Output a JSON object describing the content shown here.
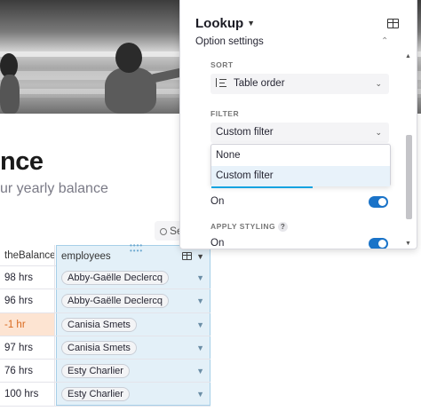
{
  "page": {
    "title": "nce",
    "subtitle": "ur yearly balance",
    "search_label": "Se"
  },
  "table": {
    "columns": {
      "balance": "theBalance",
      "employees": "employees"
    },
    "rows": [
      {
        "balance": "98 hrs",
        "employee": "Abby-Gaëlle Declercq",
        "negative": false
      },
      {
        "balance": "96 hrs",
        "employee": "Abby-Gaëlle Declercq",
        "negative": false
      },
      {
        "balance": "-1 hr",
        "employee": "Canisia Smets",
        "negative": true
      },
      {
        "balance": "97 hrs",
        "employee": "Canisia Smets",
        "negative": false
      },
      {
        "balance": "76 hrs",
        "employee": "Esty Charlier",
        "negative": false
      },
      {
        "balance": "100 hrs",
        "employee": "Esty Charlier",
        "negative": false
      }
    ]
  },
  "panel": {
    "title": "Lookup",
    "section": "Option settings",
    "sort": {
      "label": "SORT",
      "value": "Table order"
    },
    "filter": {
      "label": "FILTER",
      "value": "Custom filter",
      "options": [
        "None",
        "Custom filter"
      ],
      "selected": "Custom filter"
    },
    "filter_toggle": {
      "label": "On",
      "on": true
    },
    "apply_styling": {
      "label": "APPLY STYLING",
      "help": "?",
      "toggle_label": "On",
      "on": true
    }
  },
  "colors": {
    "accent": "#1a73c8",
    "column_highlight": "#e3f0f8",
    "negative_bg": "#fde4d2",
    "negative_text": "#d9691e"
  },
  "icons": [
    "search-icon",
    "table-icon",
    "chevron-down-icon",
    "chevron-up-icon",
    "sort-icon",
    "help-icon"
  ]
}
